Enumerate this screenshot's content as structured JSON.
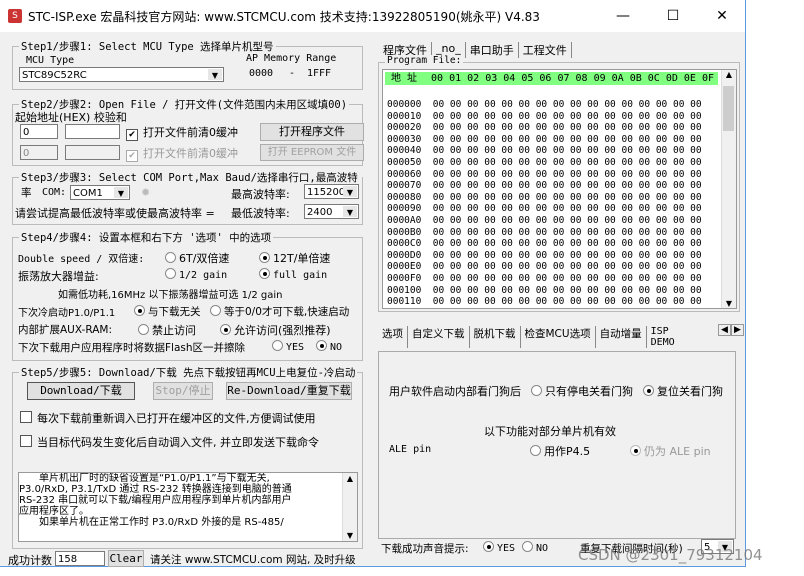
{
  "window": {
    "title": "STC-ISP.exe  宏晶科技官方网站: www.STCMCU.com  技术支持:13922805190(姚永平)  V4.83",
    "minimize": "—",
    "maximize": "☐",
    "close": "✕"
  },
  "step1": {
    "legend": "Step1/步骤1: Select MCU Type  选择单片机型号",
    "mcu_type_label": "MCU Type",
    "mcu_type": "STC89C52RC",
    "ap_label": "AP Memory Range",
    "ap_start": "0000",
    "ap_dash": "-",
    "ap_end": "1FFF"
  },
  "step2": {
    "legend": "Step2/步骤2: Open File / 打开文件(文件范围内未用区域填00)",
    "addr_label": "起始地址(HEX) 校验和",
    "addr1": "0",
    "addr2": "0",
    "clear_label": "打开文件前清0缓冲",
    "clear_label2": "打开文件前清0缓冲",
    "open_program": "打开程序文件",
    "open_eeprom": "打开 EEPROM 文件"
  },
  "step3": {
    "legend": "Step3/步骤3: Select COM Port,Max Baud/选择串行口,最高波特率",
    "com_label": "COM:",
    "com": "COM1",
    "max_baud_label": "最高波特率:",
    "max_baud": "115200",
    "hint": "请尝试提高最低波特率或使最高波特率 =",
    "min_baud_label": "最低波特率:",
    "min_baud": "2400"
  },
  "step4": {
    "legend": "Step4/步骤4: 设置本框和右下方 '选项' 中的选项",
    "double_speed_label": "Double speed / 双倍速:",
    "opt_6t": "6T/双倍速",
    "opt_12t": "12T/单倍速",
    "gain_label": "振荡放大器增益:",
    "opt_half_gain": "1/2 gain",
    "opt_full_gain": "full gain",
    "gain_note": "如需低功耗,16MHz 以下振荡器增益可选 1/2 gain",
    "cold_label": "下次冷启动P1.0/P1.1",
    "opt_unrelated": "与下载无关",
    "opt_equal": "等于0/0才可下载,快速启动",
    "aux_label": "内部扩展AUX-RAM:",
    "opt_forbid": "禁止访问",
    "opt_allow": "允许访问(强烈推荐)",
    "erase_label": "下次下载用户应用程序时将数据Flash区一并擦除",
    "opt_yes": "YES",
    "opt_no": "NO"
  },
  "step5": {
    "legend": "Step5/步骤5: Download/下载  先点下载按钮再MCU上电复位-冷启动",
    "download": "Download/下载",
    "stop": "Stop/停止",
    "redownload": "Re-Download/重复下载",
    "check1": "每次下载前重新调入已打开在缓冲区的文件,方便调试使用",
    "check2": "当目标代码发生变化后自动调入文件, 并立即发送下载命令"
  },
  "memo": [
    "　　单片机出厂时的缺省设置是“P1.0/P1.1”与下载无关,",
    "P3.0/RxD, P3.1/TxD 通过 RS-232 转换器连接到电脑的普通",
    "RS-232 串口就可以下载/编程用户应用程序到单片机内部用户",
    "应用程序区了。",
    "　　如果单片机在正常工作时 P3.0/RxD 外接的是 RS-485/"
  ],
  "status": {
    "count_label": "成功计数",
    "count": "158",
    "clear": "Clear",
    "note": "请关注 www.STCMCU.com 网站, 及时升级"
  },
  "top_tabs": [
    "程序文件",
    "_no_",
    "串口助手",
    "工程文件"
  ],
  "program_file_label": "Program File:",
  "hex": {
    "addr_header": "地 址",
    "columns": [
      "00",
      "01",
      "02",
      "03",
      "04",
      "05",
      "06",
      "07",
      "08",
      "09",
      "0A",
      "0B",
      "0C",
      "0D",
      "0E",
      "0F"
    ],
    "rows": [
      "000000",
      "000010",
      "000020",
      "000030",
      "000040",
      "000050",
      "000060",
      "000070",
      "000080",
      "000090",
      "0000A0",
      "0000B0",
      "0000C0",
      "0000D0",
      "0000E0",
      "0000F0",
      "000100",
      "000110"
    ],
    "fill": "00"
  },
  "bottom_tabs": [
    "选项",
    "自定义下载",
    "脱机下载",
    "检查MCU选项",
    "自动增量",
    "ISP DEMO"
  ],
  "options": {
    "watchdog_label": "用户软件启动内部看门狗后",
    "opt_power": "只有停电关看门狗",
    "opt_reset": "复位关看门狗",
    "partial_note": "以下功能对部分单片机有效",
    "ale_label": "ALE pin",
    "opt_p45": "用作P4.5",
    "opt_ale": "仍为 ALE pin",
    "sound_label": "下载成功声音提示:",
    "sound_yes": "YES",
    "sound_no": "NO",
    "interval_label": "重复下载间隔时间(秒)",
    "interval": "5"
  },
  "watermark": "CSDN @2301_79312104"
}
